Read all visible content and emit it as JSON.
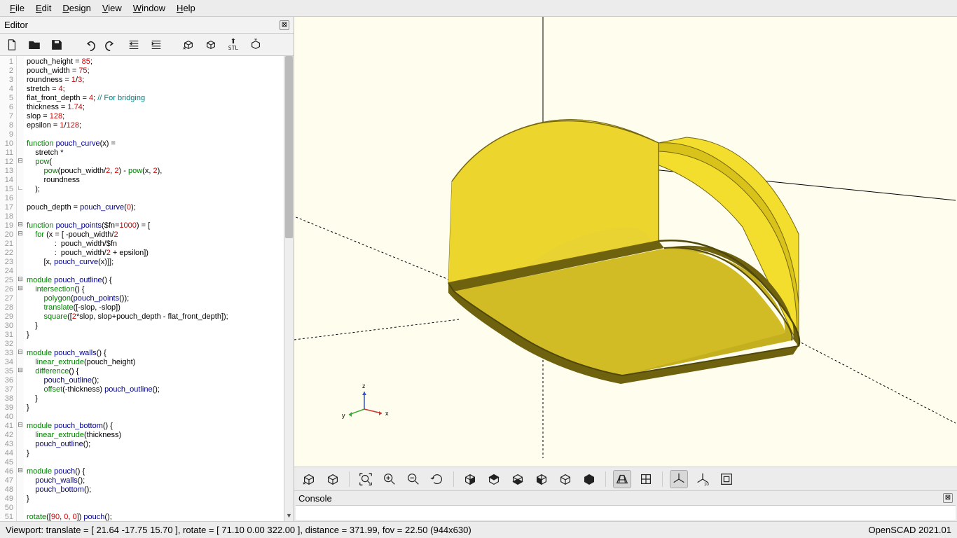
{
  "menu": {
    "items": [
      "File",
      "Edit",
      "Design",
      "View",
      "Window",
      "Help"
    ]
  },
  "editor": {
    "title": "Editor",
    "code_lines": [
      "pouch_height = 85;",
      "pouch_width = 75;",
      "roundness = 1/3;",
      "stretch = 4;",
      "flat_front_depth = 4; // For bridging",
      "thickness = 1.74;",
      "slop = 128;",
      "epsilon = 1/128;",
      "",
      "function pouch_curve(x) =",
      "    stretch *",
      "    pow(",
      "        pow(pouch_width/2, 2) - pow(x, 2),",
      "        roundness",
      "    );",
      "",
      "pouch_depth = pouch_curve(0);",
      "",
      "function pouch_points($fn=1000) = [",
      "    for (x = [ -pouch_width/2",
      "             :  pouch_width/$fn",
      "             :  pouch_width/2 + epsilon])",
      "        [x, pouch_curve(x)]];",
      "",
      "module pouch_outline() {",
      "    intersection() {",
      "        polygon(pouch_points());",
      "        translate([-slop, -slop])",
      "        square([2*slop, slop+pouch_depth - flat_front_depth]);",
      "    }",
      "}",
      "",
      "module pouch_walls() {",
      "    linear_extrude(pouch_height)",
      "    difference() {",
      "        pouch_outline();",
      "        offset(-thickness) pouch_outline();",
      "    }",
      "}",
      "",
      "module pouch_bottom() {",
      "    linear_extrude(thickness)",
      "    pouch_outline();",
      "}",
      "",
      "module pouch() {",
      "    pouch_walls();",
      "    pouch_bottom();",
      "}",
      "",
      "rotate([90, 0, 0]) pouch();"
    ],
    "line_count": 51
  },
  "console": {
    "title": "Console"
  },
  "status": {
    "viewport": "Viewport: translate = [ 21.64 -17.75 15.70 ], rotate = [ 71.10 0.00 322.00 ], distance = 371.99, fov = 22.50 (944x630)",
    "version": "OpenSCAD 2021.01"
  },
  "axis": {
    "x": "x",
    "y": "y",
    "z": "z"
  }
}
